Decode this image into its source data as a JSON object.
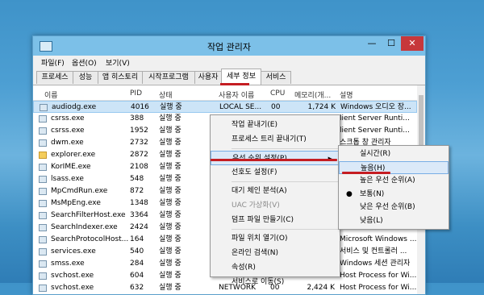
{
  "window": {
    "title": "작업 관리자",
    "min": "—",
    "max": "☐",
    "close": "✕"
  },
  "menu": [
    "파일(F)",
    "옵션(O)",
    "보기(V)"
  ],
  "tabs": [
    "프로세스",
    "성능",
    "앱 히스토리",
    "시작프로그램",
    "사용자",
    "세부 정보",
    "서비스"
  ],
  "active_tab": "세부 정보",
  "columns": [
    "이름",
    "PID",
    "상태",
    "사용자 이름",
    "CPU",
    "메모리(개...",
    "설명"
  ],
  "rows": [
    {
      "name": "audiodg.exe",
      "pid": "4016",
      "status": "실행 중",
      "user": "LOCAL SE...",
      "cpu": "00",
      "mem": "1,724 K",
      "desc": "Windows 오디오 장...",
      "selected": true,
      "icon": "process-icon"
    },
    {
      "name": "csrss.exe",
      "pid": "388",
      "status": "실행 중",
      "user": "",
      "cpu": "",
      "mem": "",
      "desc": "lient Server Runti...",
      "selected": false,
      "icon": "process-icon"
    },
    {
      "name": "csrss.exe",
      "pid": "1952",
      "status": "실행 중",
      "user": "",
      "cpu": "",
      "mem": "",
      "desc": "lient Server Runti...",
      "selected": false,
      "icon": "process-icon"
    },
    {
      "name": "dwm.exe",
      "pid": "2732",
      "status": "실행 중",
      "user": "",
      "cpu": "",
      "mem": "",
      "desc": "스크톱 창 관리자",
      "selected": false,
      "icon": "process-icon"
    },
    {
      "name": "explorer.exe",
      "pid": "2872",
      "status": "실행 중",
      "user": "",
      "cpu": "",
      "mem": "",
      "desc": "",
      "selected": false,
      "icon": "folder-icon"
    },
    {
      "name": "KorIME.exe",
      "pid": "2108",
      "status": "실행 중",
      "user": "",
      "cpu": "",
      "mem": "",
      "desc": "",
      "selected": false,
      "icon": "process-icon"
    },
    {
      "name": "lsass.exe",
      "pid": "548",
      "status": "실행 중",
      "user": "",
      "cpu": "",
      "mem": "",
      "desc": "",
      "selected": false,
      "icon": "process-icon"
    },
    {
      "name": "MpCmdRun.exe",
      "pid": "872",
      "status": "실행 중",
      "user": "",
      "cpu": "",
      "mem": "",
      "desc": "",
      "selected": false,
      "icon": "process-icon"
    },
    {
      "name": "MsMpEng.exe",
      "pid": "1348",
      "status": "실행 중",
      "user": "",
      "cpu": "",
      "mem": "",
      "desc": "",
      "selected": false,
      "icon": "process-icon"
    },
    {
      "name": "SearchFilterHost.exe",
      "pid": "3364",
      "status": "실행 중",
      "user": "",
      "cpu": "",
      "mem": "",
      "desc": "",
      "selected": false,
      "icon": "process-icon"
    },
    {
      "name": "SearchIndexer.exe",
      "pid": "2424",
      "status": "실행 중",
      "user": "",
      "cpu": "",
      "mem": "",
      "desc": "",
      "selected": false,
      "icon": "process-icon"
    },
    {
      "name": "SearchProtocolHost...",
      "pid": "164",
      "status": "실행 중",
      "user": "",
      "cpu": "",
      "mem": "",
      "desc": "Microsoft Windows ...",
      "selected": false,
      "icon": "process-icon"
    },
    {
      "name": "services.exe",
      "pid": "540",
      "status": "실행 중",
      "user": "",
      "cpu": "",
      "mem": "",
      "desc": "서비스 및 컨트롤러 ...",
      "selected": false,
      "icon": "process-icon"
    },
    {
      "name": "smss.exe",
      "pid": "284",
      "status": "실행 중",
      "user": "",
      "cpu": "",
      "mem": "",
      "desc": "Windows 세션 관리자",
      "selected": false,
      "icon": "process-icon"
    },
    {
      "name": "svchost.exe",
      "pid": "604",
      "status": "실행 중",
      "user": "",
      "cpu": "",
      "mem": "",
      "desc": "Host Process for Wi...",
      "selected": false,
      "icon": "process-icon"
    },
    {
      "name": "svchost.exe",
      "pid": "632",
      "status": "실행 중",
      "user": "NETWORK",
      "cpu": "00",
      "mem": "2,424 K",
      "desc": "Host Process for Wi...",
      "selected": false,
      "icon": "process-icon"
    }
  ],
  "context_menu": [
    {
      "label": "작업 끝내기(E)",
      "disabled": false,
      "highlighted": false,
      "submenu": false
    },
    {
      "label": "프로세스 트리 끝내기(T)",
      "disabled": false,
      "highlighted": false,
      "submenu": false
    },
    {
      "sep": true
    },
    {
      "label": "우선 순위 설정(P)",
      "disabled": false,
      "highlighted": true,
      "submenu": true
    },
    {
      "label": "선호도 설정(F)",
      "disabled": false,
      "highlighted": false,
      "submenu": false
    },
    {
      "sep": true
    },
    {
      "label": "대기 체인 분석(A)",
      "disabled": false,
      "highlighted": false,
      "submenu": false
    },
    {
      "label": "UAC 가상화(V)",
      "disabled": true,
      "highlighted": false,
      "submenu": false
    },
    {
      "label": "덤프 파일 만들기(C)",
      "disabled": false,
      "highlighted": false,
      "submenu": false
    },
    {
      "sep": true
    },
    {
      "label": "파일 위치 열기(O)",
      "disabled": false,
      "highlighted": false,
      "submenu": false
    },
    {
      "label": "온라인 검색(N)",
      "disabled": false,
      "highlighted": false,
      "submenu": false
    },
    {
      "label": "속성(R)",
      "disabled": false,
      "highlighted": false,
      "submenu": false
    },
    {
      "label": "서비스로 이동(S)",
      "disabled": false,
      "highlighted": false,
      "submenu": false
    }
  ],
  "priority_menu": [
    {
      "label": "실시간(R)",
      "highlighted": false,
      "checked": false
    },
    {
      "label": "높음(H)",
      "highlighted": true,
      "checked": false
    },
    {
      "label": "높은 우선 순위(A)",
      "highlighted": false,
      "checked": false
    },
    {
      "label": "보통(N)",
      "highlighted": false,
      "checked": true
    },
    {
      "label": "낮은 우선 순위(B)",
      "highlighted": false,
      "checked": false
    },
    {
      "label": "낮음(L)",
      "highlighted": false,
      "checked": false
    }
  ],
  "accent_red": "#c51d22",
  "selection_color": "#cce4f7"
}
